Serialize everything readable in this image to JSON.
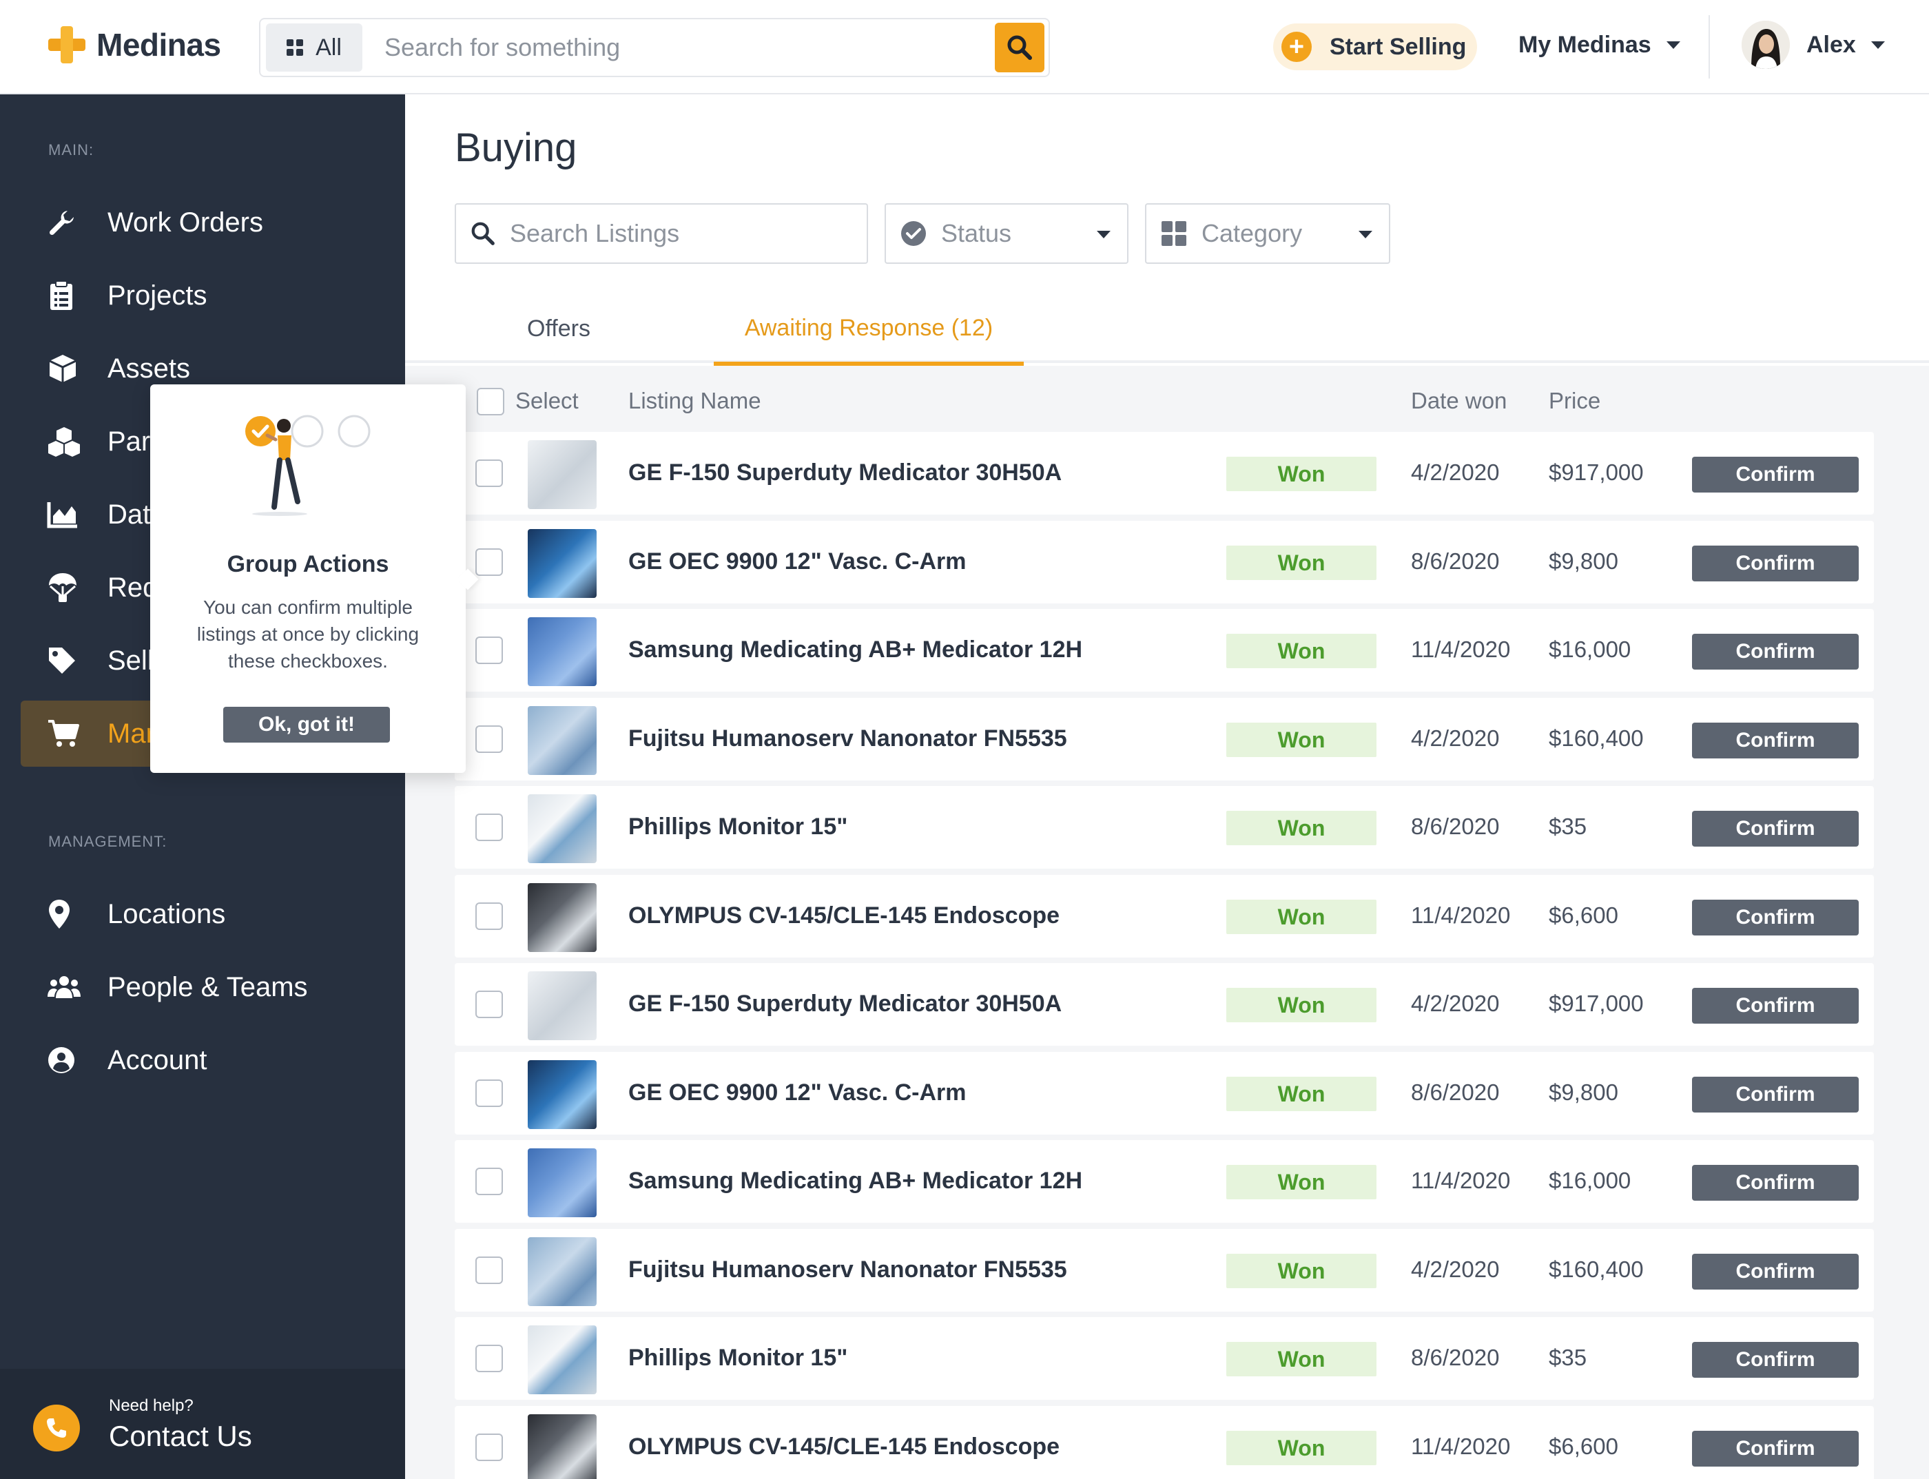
{
  "header": {
    "logo_text": "Medinas",
    "search_scope": "All",
    "search_placeholder": "Search for something",
    "start_selling": "Start Selling",
    "my_medinas": "My Medinas",
    "user_name": "Alex"
  },
  "sidebar": {
    "main_label": "MAIN:",
    "management_label": "MANAGEMENT:",
    "main_items": [
      {
        "label": "Work Orders",
        "icon": "wrench-icon"
      },
      {
        "label": "Projects",
        "icon": "clipboard-icon"
      },
      {
        "label": "Assets",
        "icon": "cube-icon"
      },
      {
        "label": "Parts",
        "icon": "boxes-icon"
      },
      {
        "label": "Data",
        "icon": "chart-icon"
      },
      {
        "label": "Requests",
        "icon": "parachute-icon"
      },
      {
        "label": "Sell",
        "icon": "tag-icon"
      },
      {
        "label": "Marketplace",
        "icon": "cart-icon",
        "active": true
      }
    ],
    "management_items": [
      {
        "label": "Locations",
        "icon": "pin-icon"
      },
      {
        "label": "People & Teams",
        "icon": "people-icon"
      },
      {
        "label": "Account",
        "icon": "account-icon"
      }
    ],
    "help_need": "Need help?",
    "help_contact": "Contact Us"
  },
  "main": {
    "title": "Buying",
    "search_listings_placeholder": "Search Listings",
    "status_filter": "Status",
    "category_filter": "Category",
    "tabs": [
      {
        "label": "Offers"
      },
      {
        "label": "Awaiting Response (12)",
        "active": true
      }
    ],
    "columns": {
      "select": "Select",
      "listing_name": "Listing Name",
      "date_won": "Date won",
      "price": "Price"
    },
    "rows": [
      {
        "name": "GE F-150 Superduty Medicator 30H50A",
        "status": "Won",
        "date": "4/2/2020",
        "price": "$917,000",
        "action": "Confirm",
        "thumb": "a"
      },
      {
        "name": "GE OEC 9900 12\" Vasc. C-Arm",
        "status": "Won",
        "date": "8/6/2020",
        "price": "$9,800",
        "action": "Confirm",
        "thumb": "b"
      },
      {
        "name": "Samsung Medicating AB+ Medicator 12H",
        "status": "Won",
        "date": "11/4/2020",
        "price": "$16,000",
        "action": "Confirm",
        "thumb": "c"
      },
      {
        "name": "Fujitsu Humanoserv Nanonator FN5535",
        "status": "Won",
        "date": "4/2/2020",
        "price": "$160,400",
        "action": "Confirm",
        "thumb": "d"
      },
      {
        "name": "Phillips Monitor 15\"",
        "status": "Won",
        "date": "8/6/2020",
        "price": "$35",
        "action": "Confirm",
        "thumb": "e"
      },
      {
        "name": "OLYMPUS CV-145/CLE-145 Endoscope",
        "status": "Won",
        "date": "11/4/2020",
        "price": "$6,600",
        "action": "Confirm",
        "thumb": "f"
      },
      {
        "name": "GE F-150 Superduty Medicator 30H50A",
        "status": "Won",
        "date": "4/2/2020",
        "price": "$917,000",
        "action": "Confirm",
        "thumb": "a"
      },
      {
        "name": "GE OEC 9900 12\" Vasc. C-Arm",
        "status": "Won",
        "date": "8/6/2020",
        "price": "$9,800",
        "action": "Confirm",
        "thumb": "b"
      },
      {
        "name": "Samsung Medicating AB+ Medicator 12H",
        "status": "Won",
        "date": "11/4/2020",
        "price": "$16,000",
        "action": "Confirm",
        "thumb": "c"
      },
      {
        "name": "Fujitsu Humanoserv Nanonator FN5535",
        "status": "Won",
        "date": "4/2/2020",
        "price": "$160,400",
        "action": "Confirm",
        "thumb": "d"
      },
      {
        "name": "Phillips Monitor 15\"",
        "status": "Won",
        "date": "8/6/2020",
        "price": "$35",
        "action": "Confirm",
        "thumb": "e"
      },
      {
        "name": "OLYMPUS CV-145/CLE-145 Endoscope",
        "status": "Won",
        "date": "11/4/2020",
        "price": "$6,600",
        "action": "Confirm",
        "thumb": "f"
      }
    ]
  },
  "tooltip": {
    "title": "Group Actions",
    "body": "You can confirm multiple listings at once by clicking these checkboxes.",
    "button": "Ok, got it!",
    "step": 1,
    "steps_total": 3
  },
  "colors": {
    "accent": "#f3a31b",
    "sidebar_bg": "#27303f",
    "won_bg": "#e6f4dc",
    "won_text": "#4c9c2d",
    "confirm_bg": "#5c6470"
  }
}
